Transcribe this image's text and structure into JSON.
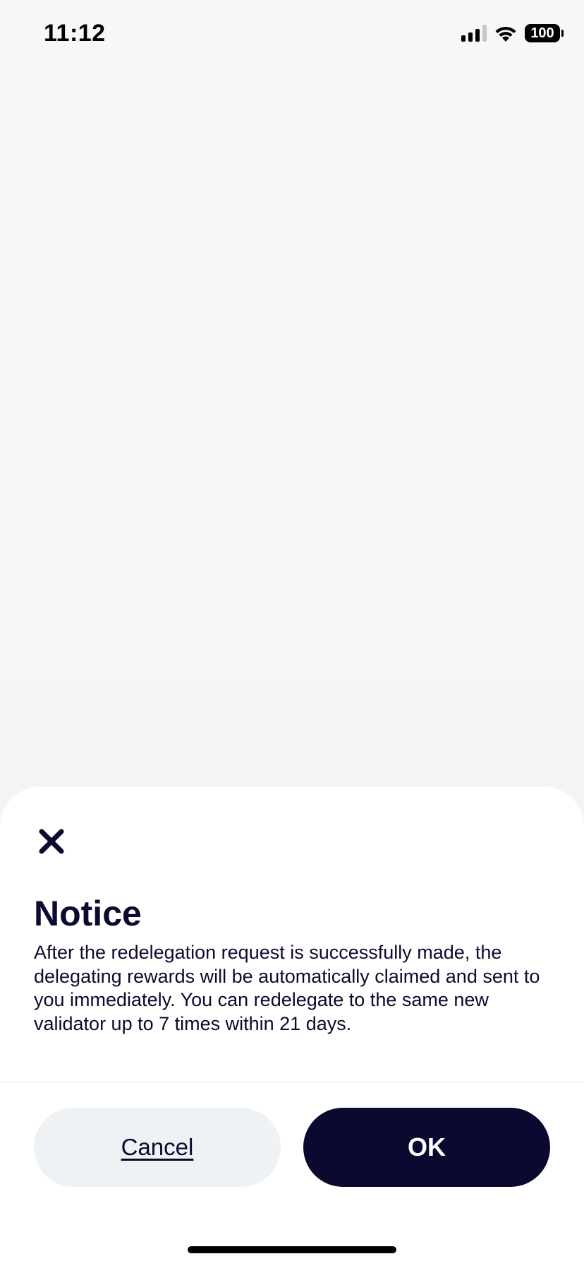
{
  "status_bar": {
    "time": "11:12",
    "battery": "100",
    "icons": [
      "signal-icon",
      "wifi-icon",
      "battery-icon"
    ]
  },
  "sheet": {
    "title": "Notice",
    "body": "After the redelegation request is successfully made, the delegating rewards will be automatically claimed and sent to you immediately. You can redelegate to the same new validator up to 7 times within 21 days.",
    "close_icon": "close-icon",
    "cancel_label": "Cancel",
    "ok_label": "OK"
  },
  "colors": {
    "primary_dark": "#0a0a30",
    "secondary_button_bg": "#eff2f5",
    "background": "#f6f6f6",
    "sheet_background": "#ffffff"
  }
}
